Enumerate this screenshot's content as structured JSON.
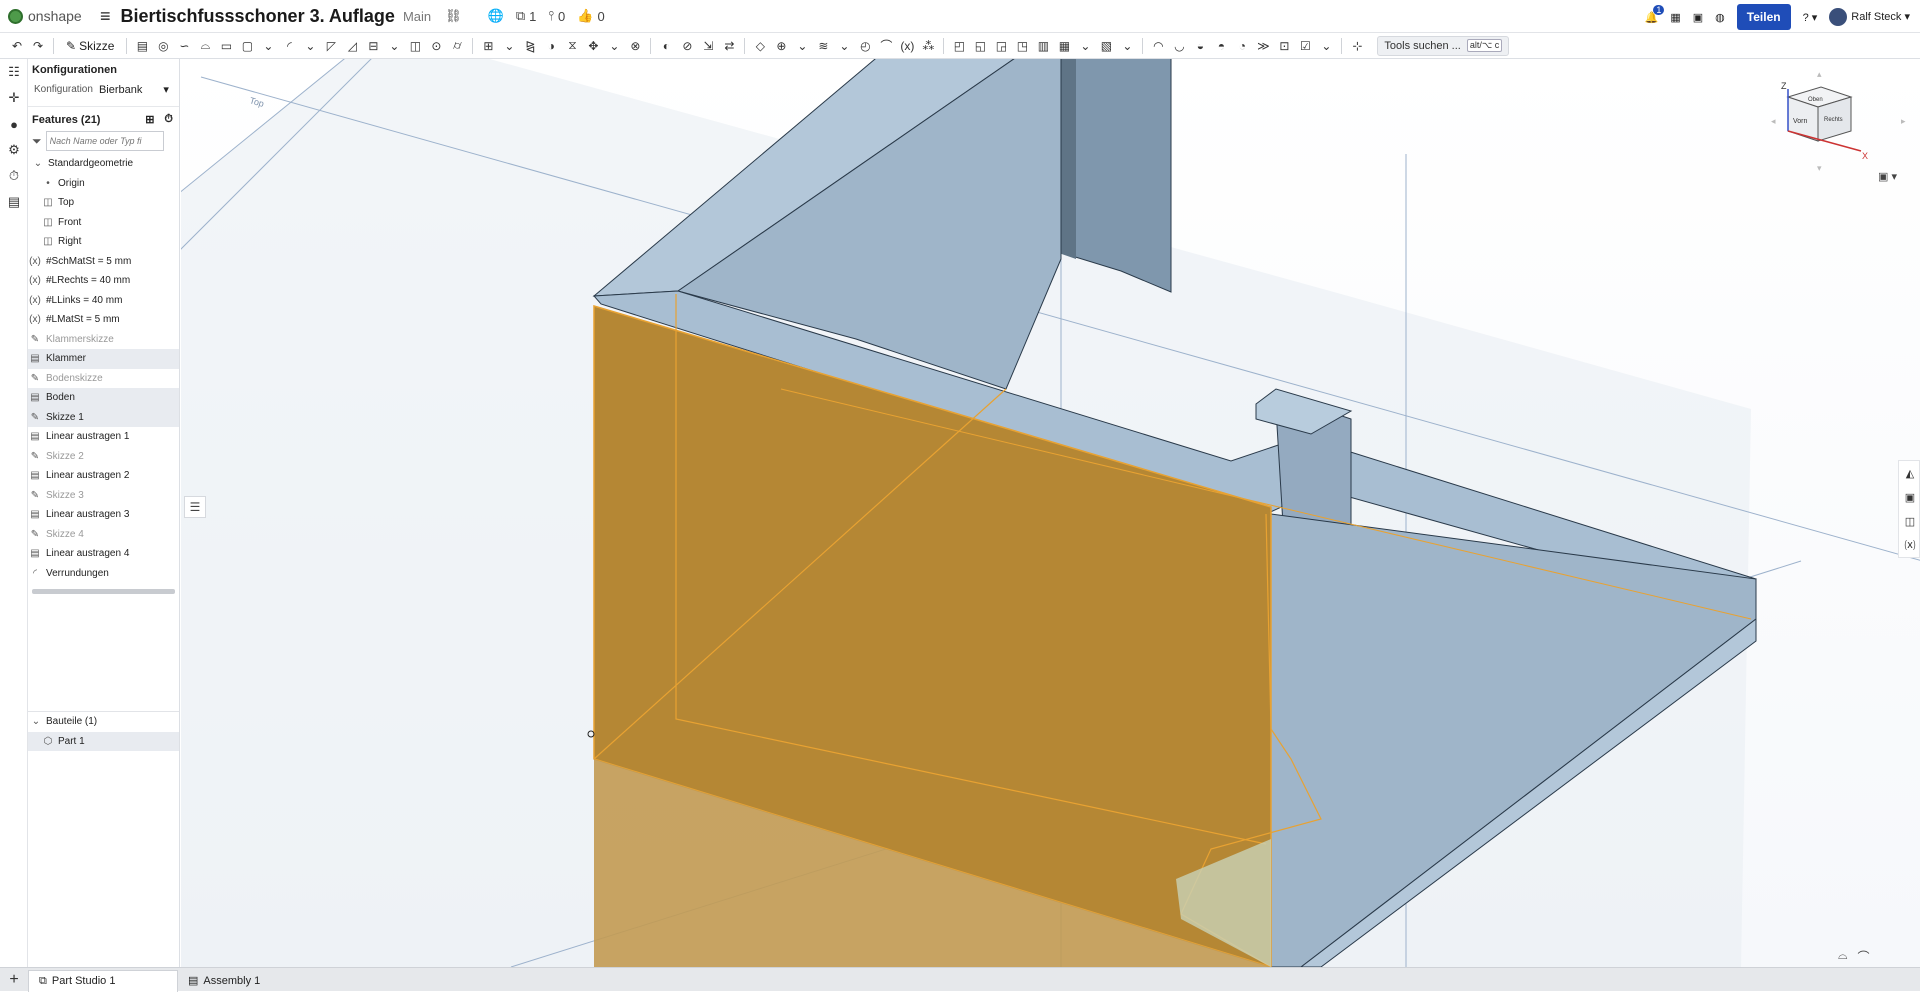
{
  "app": {
    "logo_text": "onshape"
  },
  "document": {
    "title": "Biertischfussschoner 3. Auflage",
    "branch": "Main",
    "versions_count": "1",
    "branches_count": "0",
    "likes_count": "0"
  },
  "header_right": {
    "notifications_count": "1",
    "share_label": "Teilen",
    "help_label": "?",
    "user_name": "Ralf Steck"
  },
  "toolbar": {
    "sketch_label": "Skizze",
    "tools_search_label": "Tools suchen ...",
    "tools_search_shortcut": "alt/⌥ c"
  },
  "configurations": {
    "heading": "Konfigurationen",
    "label": "Konfiguration",
    "value": "Bierbank"
  },
  "features": {
    "heading": "Features (21)",
    "filter_placeholder": "Nach Name oder Typ fi",
    "group_label": "Standardgeometrie",
    "default_geometry": [
      {
        "label": "Origin",
        "icon": "origin-icon"
      },
      {
        "label": "Top",
        "icon": "plane-icon"
      },
      {
        "label": "Front",
        "icon": "plane-icon"
      },
      {
        "label": "Right",
        "icon": "plane-icon"
      }
    ],
    "items": [
      {
        "label": "#SchMatSt = 5 mm",
        "icon": "variable-icon",
        "state": "normal"
      },
      {
        "label": "#LRechts = 40 mm",
        "icon": "variable-icon",
        "state": "normal"
      },
      {
        "label": "#LLinks = 40 mm",
        "icon": "variable-icon",
        "state": "normal"
      },
      {
        "label": "#LMatSt = 5 mm",
        "icon": "variable-icon",
        "state": "normal"
      },
      {
        "label": "Klammerskizze",
        "icon": "sketch-icon",
        "state": "dim"
      },
      {
        "label": "Klammer",
        "icon": "extrude-icon",
        "state": "selected"
      },
      {
        "label": "Bodenskizze",
        "icon": "sketch-icon",
        "state": "dim"
      },
      {
        "label": "Boden",
        "icon": "extrude-icon",
        "state": "selected"
      },
      {
        "label": "Skizze 1",
        "icon": "sketch-icon",
        "state": "selected"
      },
      {
        "label": "Linear austragen 1",
        "icon": "extrude-icon",
        "state": "normal"
      },
      {
        "label": "Skizze 2",
        "icon": "sketch-icon",
        "state": "dim"
      },
      {
        "label": "Linear austragen 2",
        "icon": "extrude-icon",
        "state": "normal"
      },
      {
        "label": "Skizze 3",
        "icon": "sketch-icon",
        "state": "dim"
      },
      {
        "label": "Linear austragen 3",
        "icon": "extrude-icon",
        "state": "normal"
      },
      {
        "label": "Skizze 4",
        "icon": "sketch-icon",
        "state": "dim"
      },
      {
        "label": "Linear austragen 4",
        "icon": "extrude-icon",
        "state": "normal"
      },
      {
        "label": "Verrundungen",
        "icon": "fillet-icon",
        "state": "normal"
      }
    ]
  },
  "parts": {
    "heading": "Bauteile (1)",
    "items": [
      {
        "label": "Part 1",
        "icon": "part-icon"
      }
    ]
  },
  "viewport": {
    "plane_label": "Top",
    "viewcube_top": "Oben",
    "viewcube_front": "Vorn",
    "viewcube_right": "Rechts",
    "axis_z": "Z",
    "axis_x": "X"
  },
  "tabs": [
    {
      "label": "Part Studio 1",
      "icon": "part-studio-icon",
      "active": true
    },
    {
      "label": "Assembly 1",
      "icon": "assembly-icon",
      "active": false
    }
  ],
  "colors": {
    "selection_orange": "#e8a232",
    "part_blue": "#9db8d2",
    "share_blue": "#1f4db8"
  }
}
